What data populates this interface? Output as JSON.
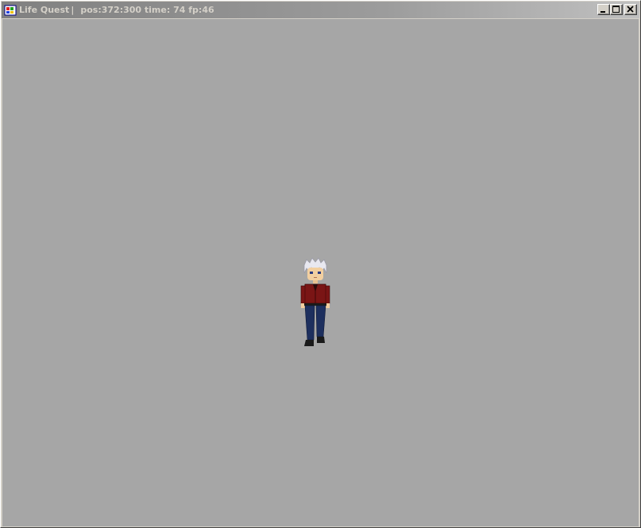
{
  "window": {
    "app_title": "Life Quest",
    "title_separator": "|",
    "status": {
      "pos_label": "pos:",
      "pos_value": "372:300",
      "time_label": "time:",
      "time_value": "74",
      "fp_label": "fp:",
      "fp_value": "46"
    },
    "controls": {
      "minimize": "minimize-icon",
      "maximize": "maximize-icon",
      "close": "close-icon"
    }
  },
  "game": {
    "background_color": "#a6a6a6",
    "player": {
      "sprite": "white-haired character in red jacket and blue jeans",
      "hair_color": "#e8e8f0",
      "jacket_color": "#7a1515",
      "pants_color": "#1d2f5e"
    }
  }
}
